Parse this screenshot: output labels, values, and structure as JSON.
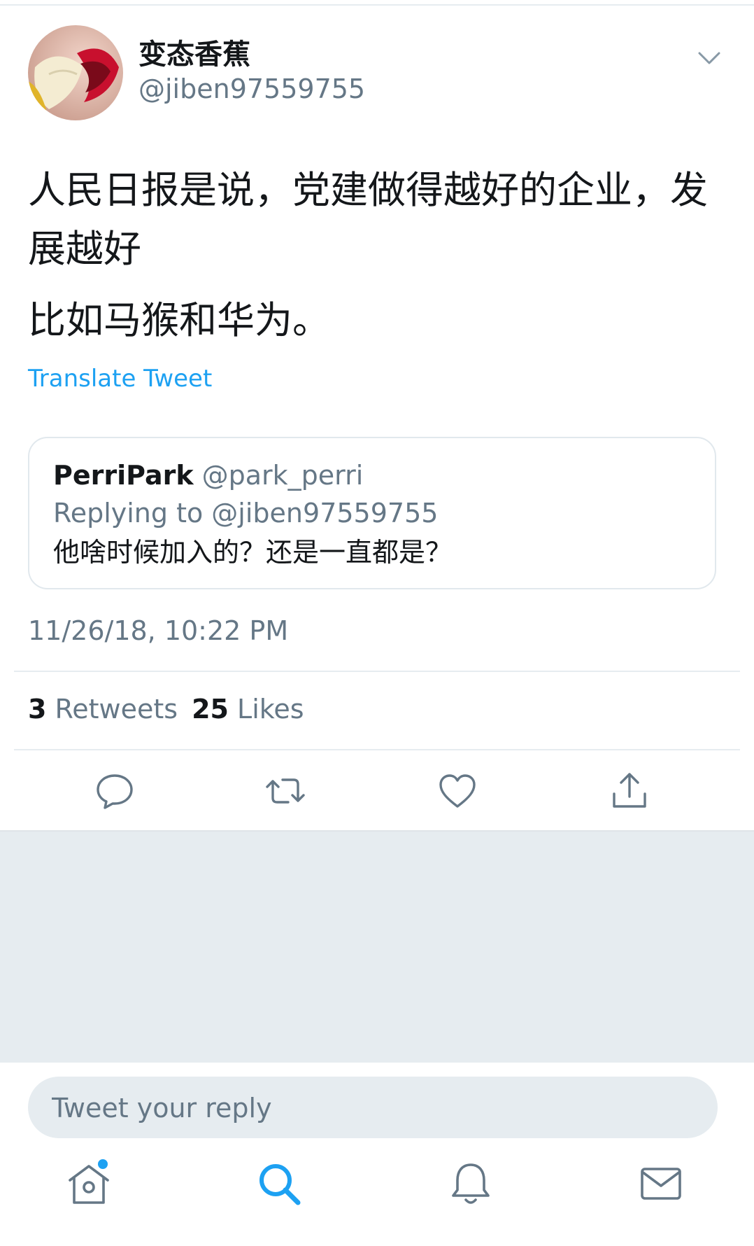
{
  "author": {
    "display_name": "变态香蕉",
    "handle": "@jiben97559755",
    "avatar_icon": "avatar-banana-lips"
  },
  "tweet": {
    "paragraphs": [
      "人民日报是说，党建做得越好的企业，发展越好",
      "比如马猴和华为。"
    ],
    "translate_label": "Translate Tweet",
    "timestamp": "11/26/18, 10:22 PM"
  },
  "quoted": {
    "name": "PerriPark",
    "handle": "@park_perri",
    "replying_to": "Replying to @jiben97559755",
    "text": "他啥时候加入的？还是一直都是？"
  },
  "stats": {
    "retweets_count": "3",
    "retweets_label": "Retweets",
    "likes_count": "25",
    "likes_label": "Likes"
  },
  "actions": [
    "reply-icon",
    "retweet-icon",
    "like-icon",
    "share-icon"
  ],
  "reply_bar": {
    "placeholder": "Tweet your reply"
  },
  "tabbar": [
    "home-icon",
    "search-icon",
    "notifications-icon",
    "messages-icon"
  ],
  "colors": {
    "accent": "#1da1f2",
    "secondary_text": "#657786",
    "divider": "#e6ecf0",
    "icon_gray": "#657786"
  }
}
